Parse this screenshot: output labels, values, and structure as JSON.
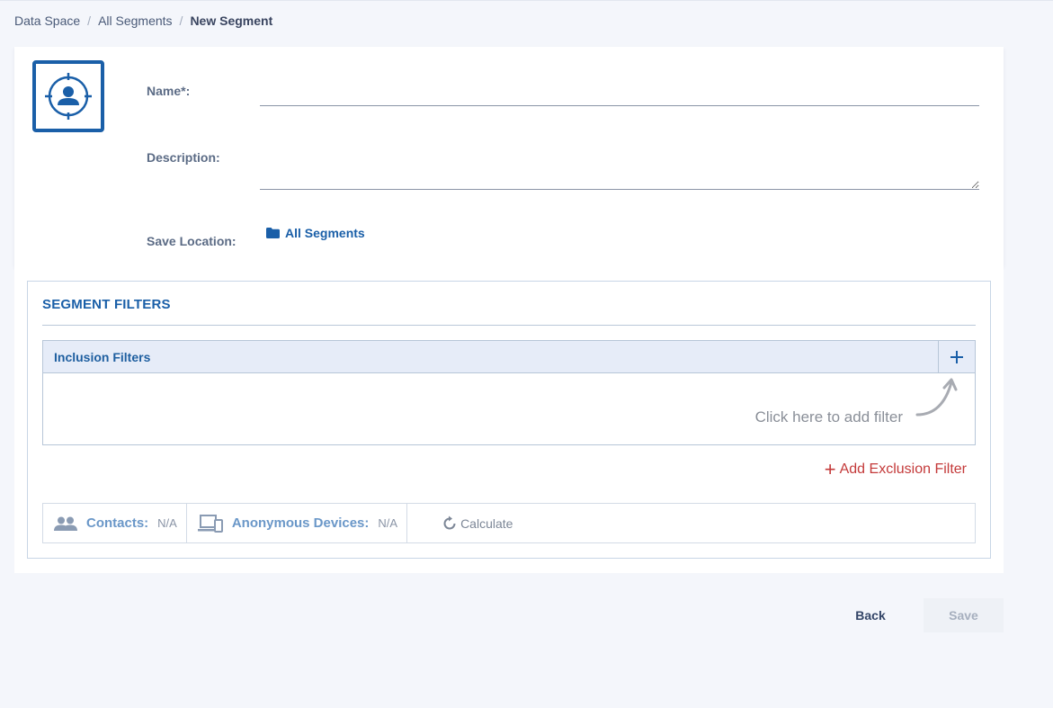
{
  "breadcrumb": {
    "items": [
      "Data Space",
      "All Segments"
    ],
    "current": "New Segment",
    "separator": "/"
  },
  "form": {
    "name_label": "Name*:",
    "name_value": "",
    "description_label": "Description:",
    "description_value": "",
    "save_location_label": "Save Location:",
    "save_location_value": "All Segments"
  },
  "filters": {
    "title": "SEGMENT FILTERS",
    "inclusion_title": "Inclusion Filters",
    "add_hint": "Click here to add filter",
    "add_exclusion_label": "Add Exclusion Filter",
    "contacts_label": "Contacts:",
    "contacts_value": "N/A",
    "devices_label": "Anonymous Devices:",
    "devices_value": "N/A",
    "calculate_label": "Calculate"
  },
  "footer": {
    "back_label": "Back",
    "save_label": "Save"
  },
  "colors": {
    "primary": "#1a5fa8",
    "danger": "#c43a3a",
    "background": "#f4f6fb"
  }
}
